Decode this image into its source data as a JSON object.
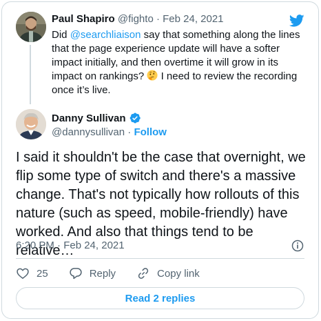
{
  "quoted_tweet": {
    "author_name": "Paul Shapiro",
    "handle": "@fighto",
    "separator": " · ",
    "date": "Feb 24, 2021",
    "text_before": "Did ",
    "mention": "@searchliaison",
    "text_after": " say that something along the lines that the page experience update will have a softer impact initially, and then overtime it will grow in its impact on rankings? ",
    "text_end": " I need to review the recording once it’s live."
  },
  "tweet": {
    "author_name": "Danny Sullivan",
    "handle": "@dannysullivan",
    "dot": " · ",
    "follow_label": "Follow",
    "text": "I said it shouldn't be the case that overnight, we flip some type of switch and there's a massive change. That's not typically how rollouts of this nature (such as speed, mobile-friendly) have worked. And also that things tend to be relative…",
    "timestamp": "6:20 PM · Feb 24, 2021"
  },
  "actions": {
    "like_count": "25",
    "reply_label": "Reply",
    "copy_link_label": "Copy link"
  },
  "read_replies_label": "Read 2 replies",
  "icons": {
    "brand": "twitter-bird-icon",
    "verified": "verified-badge-icon",
    "emoji": "thinking-face-emoji",
    "info": "info-icon",
    "like": "heart-icon",
    "reply": "speech-bubble-icon",
    "copy_link": "link-icon"
  },
  "colors": {
    "accent": "#1d9bf0",
    "text": "#0f1419",
    "secondary": "#536471",
    "border": "#cfd9de"
  }
}
